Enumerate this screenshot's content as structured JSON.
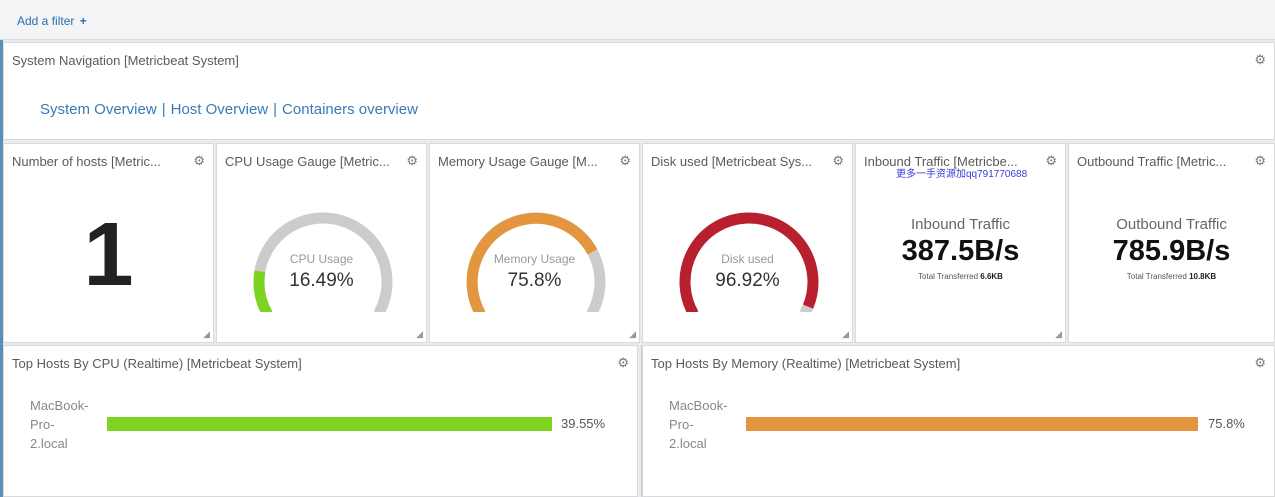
{
  "filter_bar": {
    "add_filter_label": "Add a filter",
    "plus_icon": "+"
  },
  "navigation_panel": {
    "title": "System Navigation [Metricbeat System]",
    "links": [
      "System Overview",
      "Host Overview",
      "Containers overview"
    ],
    "separator": "|"
  },
  "hosts_panel": {
    "title": "Number of hosts [Metric...",
    "value": "1"
  },
  "cpu_panel": {
    "title": "CPU Usage Gauge [Metric...",
    "label": "CPU Usage",
    "value": "16.49%",
    "fraction": 0.1649,
    "color": "#7ed321"
  },
  "memory_panel": {
    "title": "Memory Usage Gauge [M...",
    "label": "Memory Usage",
    "value": "75.8%",
    "fraction": 0.758,
    "color": "#e3963e"
  },
  "disk_panel": {
    "title": "Disk used [Metricbeat Sys...",
    "label": "Disk used",
    "value": "96.92%",
    "fraction": 0.9692,
    "color": "#b8202d"
  },
  "inbound_panel": {
    "title": "Inbound Traffic [Metricbe...",
    "watermark": "更多一手资源加qq791770688",
    "label": "Inbound Traffic",
    "value": "387.5B/s",
    "sub_label": "Total Transferred",
    "sub_value": "6.6KB"
  },
  "outbound_panel": {
    "title": "Outbound Traffic [Metric...",
    "label": "Outbound Traffic",
    "value": "785.9B/s",
    "sub_label": "Total Transferred",
    "sub_value": "10.8KB"
  },
  "top_cpu_panel": {
    "title": "Top Hosts By CPU (Realtime) [Metricbeat System]",
    "host": "MacBook-Pro-2.local",
    "value": "39.55%",
    "color": "#7ed321"
  },
  "top_memory_panel": {
    "title": "Top Hosts By Memory (Realtime) [Metricbeat System]",
    "host": "MacBook-Pro-2.local",
    "value": "75.8%",
    "color": "#e3963e"
  },
  "gauge_track_color": "#cccccc",
  "icons": {
    "gear": "gear-icon",
    "resize": "resize-handle-icon"
  }
}
